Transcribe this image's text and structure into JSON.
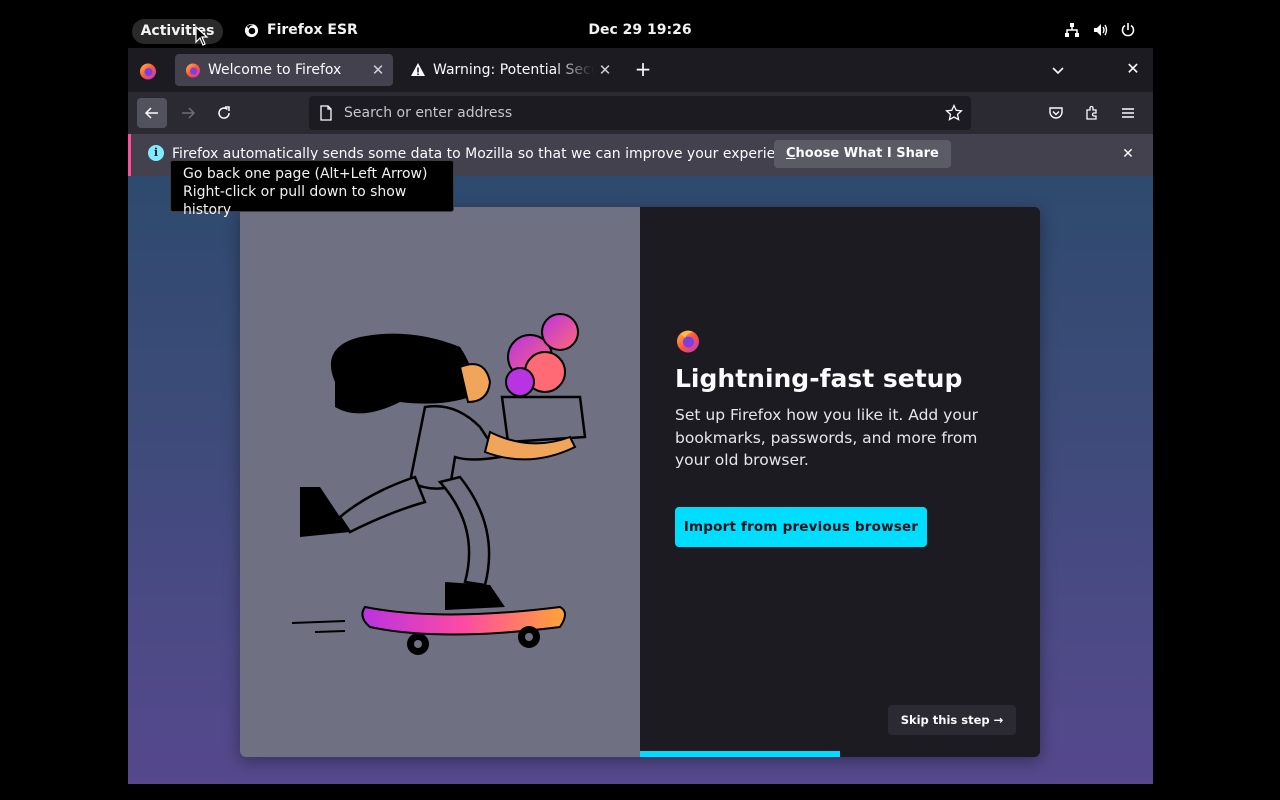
{
  "desktop": {
    "activities_label": "Activities",
    "app_name": "Firefox ESR",
    "clock": "Dec 29  19:26",
    "tray_icons": [
      "network-icon",
      "volume-icon",
      "power-icon"
    ]
  },
  "browser": {
    "tabs": [
      {
        "title": "Welcome to Firefox",
        "icon": "firefox-icon",
        "active": true
      },
      {
        "title": "Warning: Potential Security Risk Ahead",
        "icon": "warning-icon",
        "active": false
      }
    ],
    "url_placeholder": "Search or enter address",
    "notification": {
      "message": "Firefox automatically sends some data to Mozilla so that we can improve your experience.",
      "button_label_first": "C",
      "button_label_rest": "hoose What I Share"
    },
    "tooltip": {
      "line1": "Go back one page (Alt+Left Arrow)",
      "line2": "Right-click or pull down to show history"
    }
  },
  "onboarding": {
    "heading": "Lightning-fast setup",
    "subtitle": "Set up Firefox how you like it. Add your bookmarks, passwords, and more from your old browser.",
    "primary_button": "Import from previous browser",
    "skip_button": "Skip this step",
    "skip_arrow": "→",
    "progress_fraction": 0.5
  },
  "colors": {
    "accent": "#00ddff",
    "notification_stripe": "#ff4f9a",
    "toolbar": "#2b2a33",
    "tabstrip": "#1c1b22"
  }
}
